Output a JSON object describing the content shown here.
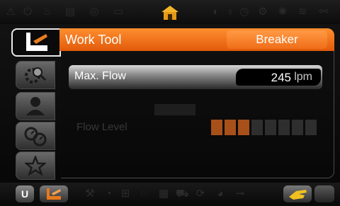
{
  "top_indicators": [
    "warning-icon",
    "power-icon",
    "coolant-icon",
    "engine-icon",
    "battery-icon",
    "home-icon",
    "hydraulic-icon",
    "wrench-icon",
    "gear-icon",
    "beacon-icon",
    "seatbelt-icon"
  ],
  "tabs": [
    {
      "name": "work-tool",
      "active": true
    },
    {
      "name": "settings",
      "active": false
    },
    {
      "name": "user",
      "active": false
    },
    {
      "name": "gauges",
      "active": false
    },
    {
      "name": "favorites",
      "active": false
    }
  ],
  "work_tool": {
    "label": "Work Tool",
    "value": "Breaker"
  },
  "max_flow": {
    "label": "Max. Flow",
    "value": "245",
    "unit": "lpm"
  },
  "flow_level": {
    "label": "Flow Level",
    "level": 3,
    "segments": 8
  },
  "bottom": {
    "u_label": "U"
  },
  "colors": {
    "accent": "#f07a1e",
    "active_seg": "#a8501a",
    "inactive_seg": "#2e2e2e"
  }
}
